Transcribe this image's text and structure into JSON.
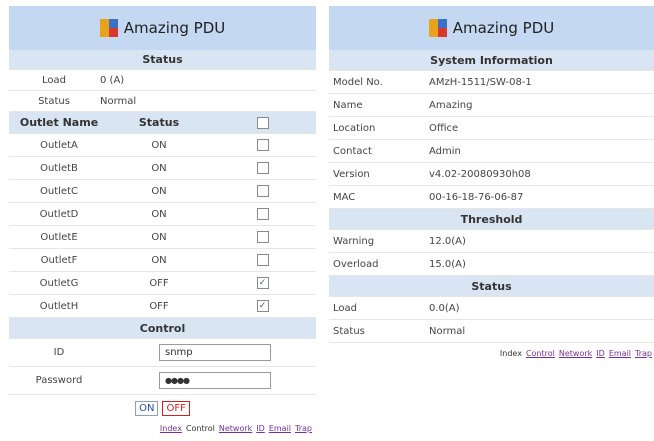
{
  "left": {
    "app_title": "Amazing PDU",
    "status_header": "Status",
    "load_label": "Load",
    "load_value": "0 (A)",
    "status_label": "Status",
    "status_value": "Normal",
    "outlet_name_header": "Outlet Name",
    "outlet_status_header": "Status",
    "outlets": [
      {
        "name": "OutletA",
        "state": "ON",
        "checked": false
      },
      {
        "name": "OutletB",
        "state": "ON",
        "checked": false
      },
      {
        "name": "OutletC",
        "state": "ON",
        "checked": false
      },
      {
        "name": "OutletD",
        "state": "ON",
        "checked": false
      },
      {
        "name": "OutletE",
        "state": "ON",
        "checked": false
      },
      {
        "name": "OutletF",
        "state": "ON",
        "checked": false
      },
      {
        "name": "OutletG",
        "state": "OFF",
        "checked": true
      },
      {
        "name": "OutletH",
        "state": "OFF",
        "checked": true
      }
    ],
    "control_header": "Control",
    "id_label": "ID",
    "id_value": "snmp",
    "password_label": "Password",
    "password_value": "●●●●",
    "on_button": "ON",
    "off_button": "OFF",
    "nav": {
      "index": "Index",
      "control": "Control",
      "network": "Network",
      "id": "ID",
      "email": "Email",
      "trap": "Trap"
    }
  },
  "right": {
    "app_title": "Amazing PDU",
    "sysinfo_header": "System Information",
    "sysinfo": [
      {
        "label": "Model No.",
        "value": "AMzH-1511/SW-08-1"
      },
      {
        "label": "Name",
        "value": "Amazing"
      },
      {
        "label": "Location",
        "value": "Office"
      },
      {
        "label": "Contact",
        "value": "Admin"
      },
      {
        "label": "Version",
        "value": "v4.02-20080930h08"
      },
      {
        "label": "MAC",
        "value": "00-16-18-76-06-87"
      }
    ],
    "threshold_header": "Threshold",
    "threshold": [
      {
        "label": "Warning",
        "value": "12.0(A)"
      },
      {
        "label": "Overload",
        "value": "15.0(A)"
      }
    ],
    "status_header": "Status",
    "status": [
      {
        "label": "Load",
        "value": "0.0(A)"
      },
      {
        "label": "Status",
        "value": "Normal"
      }
    ],
    "nav": {
      "index": "Index",
      "control": "Control",
      "network": "Network",
      "id": "ID",
      "email": "Email",
      "trap": "Trap"
    }
  },
  "colors": {
    "title_bg": "#c5d8f2",
    "header_bg": "#d9e5f3",
    "link": "#7a2e9c",
    "off_red": "#cc2222"
  }
}
